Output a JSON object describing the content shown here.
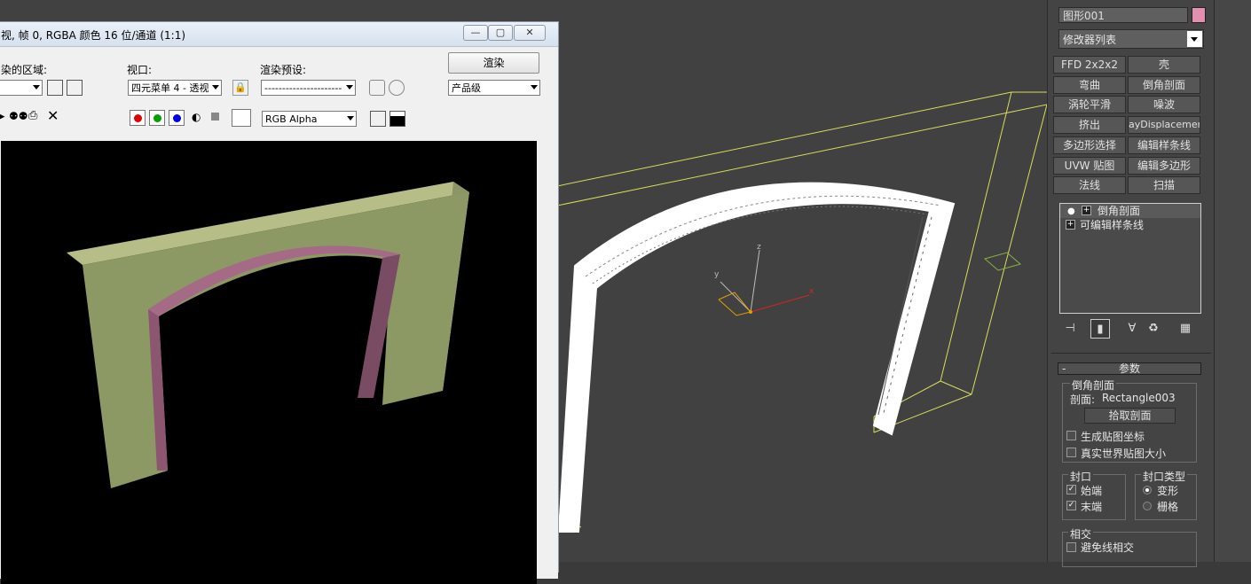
{
  "render_window": {
    "title": "视, 帧 0, RGBA 颜色 16 位/通道 (1:1)",
    "area_label": "染的区域:",
    "viewport_label": "视口:",
    "viewport_value": "四元菜单 4 - 透视",
    "preset_label": "渲染预设:",
    "preset_value": "----------------------",
    "render_button": "渲染",
    "quality_value": "产品级",
    "channel_value": "RGB Alpha",
    "channel_colors": {
      "red": "#e00000",
      "green": "#00a000",
      "blue": "#0000e0"
    }
  },
  "viewport": {
    "axis_x": "x",
    "axis_y": "y",
    "axis_z": "z"
  },
  "command_panel": {
    "object_name": "图形001",
    "object_color": "#e58fae",
    "modifier_list": "修改器列表",
    "modifier_buttons": [
      [
        "FFD 2x2x2",
        "壳"
      ],
      [
        "弯曲",
        "倒角剖面"
      ],
      [
        "涡轮平滑",
        "噪波"
      ],
      [
        "挤出",
        "ayDisplacementM"
      ],
      [
        "多边形选择",
        "编辑样条线"
      ],
      [
        "UVW 贴图",
        "编辑多边形"
      ],
      [
        "法线",
        "扫描"
      ]
    ],
    "stack": [
      "倒角剖面",
      "可编辑样条线"
    ],
    "params": {
      "rollout_title": "参数",
      "group_bevel": "倒角剖面",
      "profile_label": "剖面:",
      "profile_value": "Rectangle003",
      "pick_button": "拾取剖面",
      "gen_map_coords": "生成贴图坐标",
      "real_world_map": "真实世界贴图大小",
      "cap_group": "封口",
      "cap_start": "始端",
      "cap_end": "末端",
      "cap_type_group": "封口类型",
      "cap_morph": "变形",
      "cap_grid": "栅格",
      "intersect_group": "相交",
      "avoid_intersect": "避免线相交"
    }
  }
}
